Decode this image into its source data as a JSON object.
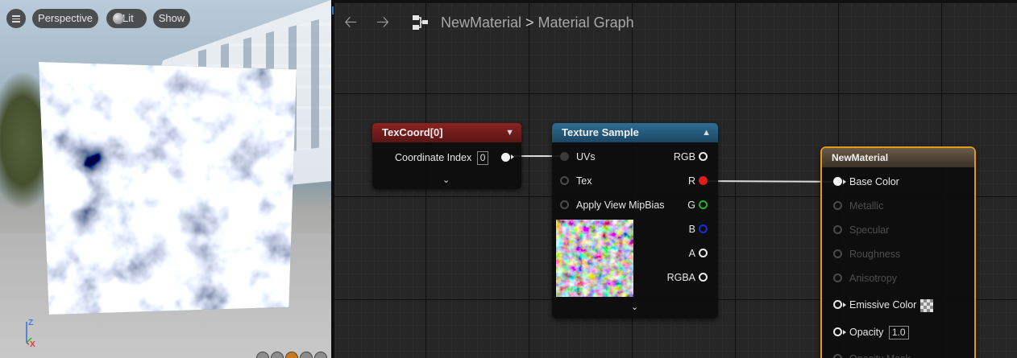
{
  "viewport": {
    "buttons": {
      "menu_icon": "hamburger-icon",
      "perspective": "Perspective",
      "lit": "Lit",
      "show": "Show"
    },
    "gizmo": {
      "z": "Z",
      "x": "X"
    }
  },
  "breadcrumb": {
    "asset": "NewMaterial",
    "separator": ">",
    "graph": "Material Graph"
  },
  "nodes": {
    "texcoord": {
      "title": "TexCoord[0]",
      "param_label": "Coordinate Index",
      "param_value": "0"
    },
    "texture_sample": {
      "title": "Texture Sample",
      "inputs": [
        "UVs",
        "Tex",
        "Apply View MipBias"
      ],
      "outputs": [
        "RGB",
        "R",
        "G",
        "B",
        "A",
        "RGBA"
      ]
    },
    "material": {
      "title": "NewMaterial",
      "inputs": {
        "base_color": "Base Color",
        "metallic": "Metallic",
        "specular": "Specular",
        "roughness": "Roughness",
        "anisotropy": "Anisotropy",
        "emissive_color": "Emissive Color",
        "opacity": "Opacity",
        "opacity_value": "1.0",
        "opacity_mask": "Opacity Mask"
      }
    }
  },
  "colors": {
    "accent_selected": "#e09a1c",
    "texcoord_header": "#8c2323",
    "texture_sample_header": "#2f6d93",
    "pin_r": "#e01b1b",
    "pin_g": "#22b522",
    "pin_b": "#1c2cd6"
  }
}
